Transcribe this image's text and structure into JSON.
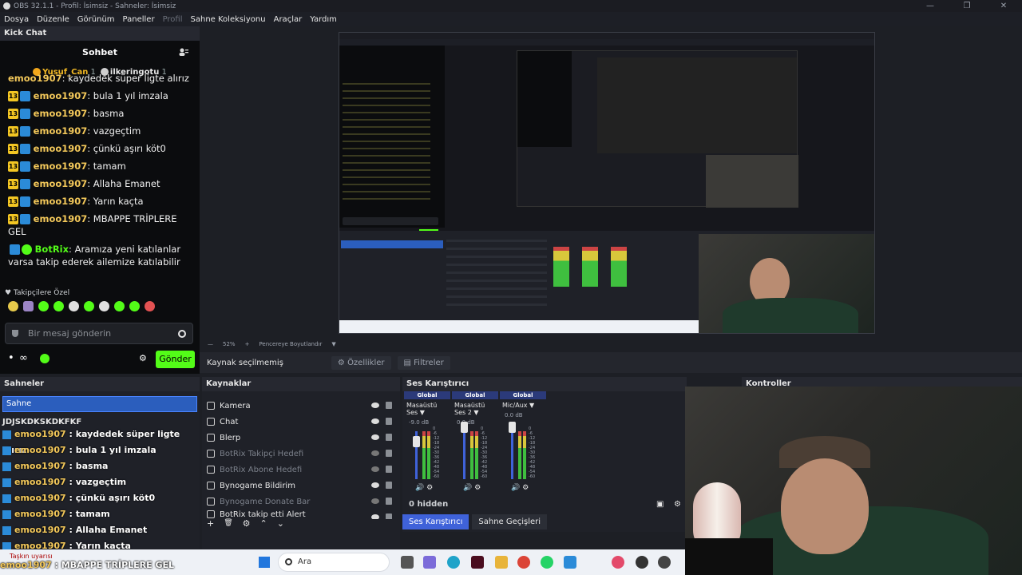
{
  "window": {
    "title": "OBS 32.1.1 - Profil: İsimsiz - Sahneler: İsimsiz",
    "controls": [
      "—",
      "❐",
      "✕"
    ]
  },
  "menu": [
    "Dosya",
    "Düzenle",
    "Görünüm",
    "Paneller",
    "Profil",
    "Sahne Koleksiyonu",
    "Araçlar",
    "Yardım"
  ],
  "kick": {
    "dock_title": "Kick Chat",
    "header": "Sohbet",
    "pinned": [
      {
        "name": "Yusuf_Can",
        "count": "1"
      },
      {
        "name": "ilkeringotu",
        "count": "1"
      }
    ],
    "messages": [
      {
        "badge": "",
        "user": "emoo1907",
        "text": "kaydedek süper ligte alırız",
        "partial": true
      },
      {
        "badge": "13",
        "user": "emoo1907",
        "text": "bula 1 yıl imzala"
      },
      {
        "badge": "13",
        "user": "emoo1907",
        "text": "basma"
      },
      {
        "badge": "13",
        "user": "emoo1907",
        "text": "vazgeçtim"
      },
      {
        "badge": "13",
        "user": "emoo1907",
        "text": "çünkü aşırı köt0"
      },
      {
        "badge": "13",
        "user": "emoo1907",
        "text": "tamam"
      },
      {
        "badge": "13",
        "user": "emoo1907",
        "text": "Allaha Emanet"
      },
      {
        "badge": "13",
        "user": "emoo1907",
        "text": "Yarın kaçta"
      },
      {
        "badge": "13",
        "user": "emoo1907",
        "text": "MBAPPE TRİPLERE GEL"
      }
    ],
    "bot_message": {
      "user": "BotRix",
      "text": "Aramıza yeni katılanlar varsa takip ederek ailemize katılabilir"
    },
    "followers_label": "Takipçilere Özel",
    "input_placeholder": "Bir mesaj gönderin",
    "send_label": "Gönder",
    "infinity": "∞"
  },
  "preview": {
    "zoom": "52%",
    "zoom_plus": "+",
    "fit_label": "Pencereye Boyutlandır"
  },
  "props": {
    "no_source": "Kaynak seçilmemiş",
    "properties": "Özellikler",
    "filters": "Filtreler"
  },
  "scenes": {
    "title": "Sahneler",
    "items": [
      "Sahne"
    ],
    "scrambled": "JDJSKDKSKDKFKF"
  },
  "scene_overlay": [
    {
      "user": "emoo1907",
      "text": "kaydedek süper ligte alırız"
    },
    {
      "user": "emoo1907",
      "text": "bula 1 yıl imzala"
    },
    {
      "user": "emoo1907",
      "text": "basma"
    },
    {
      "user": "emoo1907",
      "text": "vazgeçtim"
    },
    {
      "user": "emoo1907",
      "text": "çünkü aşırı köt0"
    },
    {
      "user": "emoo1907",
      "text": "tamam"
    },
    {
      "user": "emoo1907",
      "text": "Allaha Emanet"
    },
    {
      "user": "emoo1907",
      "text": "Yarın kaçta"
    }
  ],
  "sources": {
    "title": "Kaynaklar",
    "items": [
      {
        "name": "Kamera",
        "dim": false
      },
      {
        "name": "Chat",
        "dim": false
      },
      {
        "name": "Blerp",
        "dim": false
      },
      {
        "name": "BotRix Takipçi Hedefi",
        "dim": true
      },
      {
        "name": "BotRix Abone Hedefi",
        "dim": true
      },
      {
        "name": "Bynogame Bildirim",
        "dim": false
      },
      {
        "name": "Bynogame Donate Bar",
        "dim": true
      },
      {
        "name": "BotRix takip etti Alert",
        "dim": false
      }
    ],
    "tools": [
      "+",
      "🗑",
      "⚙",
      "⌃",
      "⌄"
    ]
  },
  "mixer": {
    "title": "Ses Karıştırıcı",
    "channels": [
      {
        "global": "Global",
        "name": "Masaüstü Ses",
        "db": "-9.0 dB"
      },
      {
        "global": "Global",
        "name": "Masaüstü Ses 2",
        "db": "0.0 dB"
      },
      {
        "global": "Global",
        "name": "Mic/Aux",
        "db": "0.0 dB"
      }
    ],
    "scale": [
      "0",
      "-6",
      "-12",
      "-18",
      "-24",
      "-30",
      "-36",
      "-42",
      "-48",
      "-54",
      "-60"
    ],
    "hidden": "0 hidden",
    "tabs": [
      "Ses Karıştırıcı",
      "Sahne Geçişleri"
    ]
  },
  "controls": {
    "title": "Kontroller"
  },
  "taskbar": {
    "search": "Ara",
    "weather": "Taşkın uyarısı",
    "overlay_user": "emoo1907",
    "overlay_text": "MBAPPE TRİPLERE GEL"
  },
  "colors": {
    "accent": "#3f62d9",
    "kick_green": "#53fc18",
    "badge_yellow": "#f3c623",
    "username": "#f3c85a"
  }
}
